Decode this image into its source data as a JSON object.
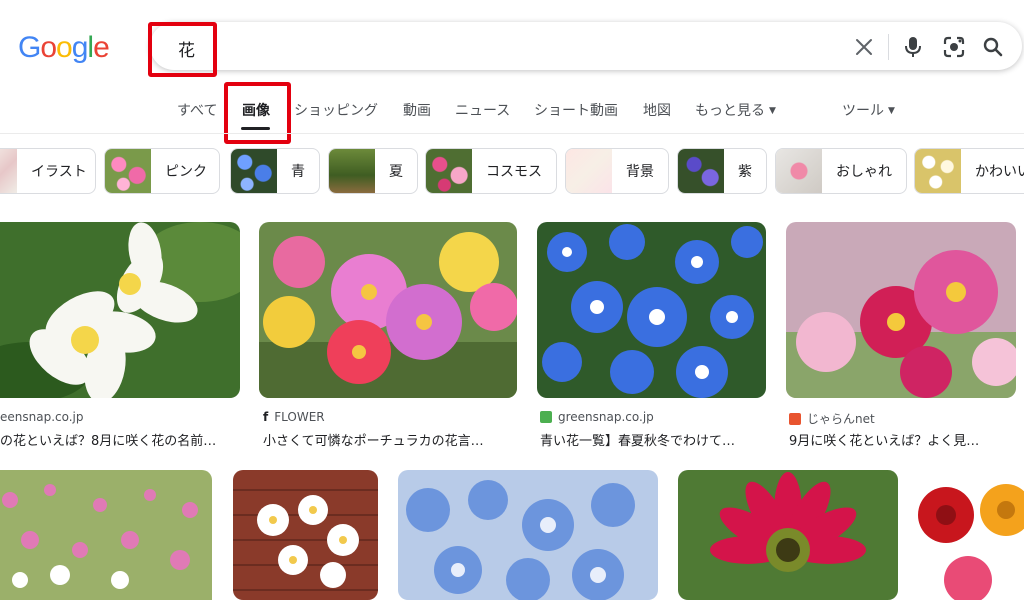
{
  "brand": {
    "logo_letters": [
      "G",
      "o",
      "o",
      "g",
      "l",
      "e"
    ],
    "logo_colors": [
      "#4285F4",
      "#EA4335",
      "#FBBC05",
      "#4285F4",
      "#34A853",
      "#EA4335"
    ]
  },
  "search": {
    "query": "花"
  },
  "tabs": [
    {
      "label": "すべて"
    },
    {
      "label": "画像",
      "active": true
    },
    {
      "label": "ショッピング"
    },
    {
      "label": "動画"
    },
    {
      "label": "ニュース"
    },
    {
      "label": "ショート動画"
    },
    {
      "label": "地図"
    },
    {
      "label": "もっと見る",
      "dropdown": true
    },
    {
      "label": "ツール",
      "dropdown": true
    }
  ],
  "chips": [
    {
      "label": "イラスト"
    },
    {
      "label": "ピンク"
    },
    {
      "label": "青"
    },
    {
      "label": "夏"
    },
    {
      "label": "コスモス"
    },
    {
      "label": "背景"
    },
    {
      "label": "紫"
    },
    {
      "label": "おしゃれ"
    },
    {
      "label": "かわいい"
    }
  ],
  "results_row1": [
    {
      "source": "eensnap.co.jp",
      "title": "の花といえば？8月に咲く花の名前…"
    },
    {
      "source": "FLOWER",
      "title": "小さくて可憐なポーチュラカの花言…"
    },
    {
      "source": "greensnap.co.jp",
      "title": "青い花一覧】春夏秋冬でわけて…"
    },
    {
      "source": "じゃらんnet",
      "title": "9月に咲く花といえば？よく見…"
    }
  ],
  "icons": {
    "clear": "close-icon",
    "voice": "microphone-icon",
    "lens": "camera-lens-icon",
    "search": "search-icon"
  },
  "colors": {
    "highlight": "#e3000f",
    "text": "#202124",
    "secondary": "#4d5156"
  }
}
